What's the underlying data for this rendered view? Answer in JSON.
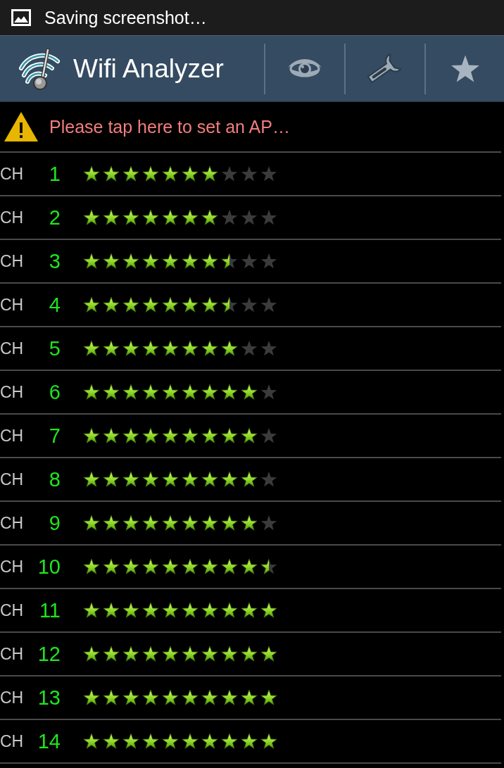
{
  "status_bar": {
    "notification": "Saving screenshot…"
  },
  "action_bar": {
    "title": "Wifi Analyzer"
  },
  "warning": {
    "text": "Please tap here to set an AP…"
  },
  "channels": [
    {
      "label": "CH",
      "number": "1",
      "stars": 7
    },
    {
      "label": "CH",
      "number": "2",
      "stars": 7
    },
    {
      "label": "CH",
      "number": "3",
      "stars": 7.5
    },
    {
      "label": "CH",
      "number": "4",
      "stars": 7.5
    },
    {
      "label": "CH",
      "number": "5",
      "stars": 8
    },
    {
      "label": "CH",
      "number": "6",
      "stars": 9
    },
    {
      "label": "CH",
      "number": "7",
      "stars": 9
    },
    {
      "label": "CH",
      "number": "8",
      "stars": 9
    },
    {
      "label": "CH",
      "number": "9",
      "stars": 9
    },
    {
      "label": "CH",
      "number": "10",
      "stars": 9.5
    },
    {
      "label": "CH",
      "number": "11",
      "stars": 10
    },
    {
      "label": "CH",
      "number": "12",
      "stars": 10
    },
    {
      "label": "CH",
      "number": "13",
      "stars": 10
    },
    {
      "label": "CH",
      "number": "14",
      "stars": 10
    }
  ]
}
